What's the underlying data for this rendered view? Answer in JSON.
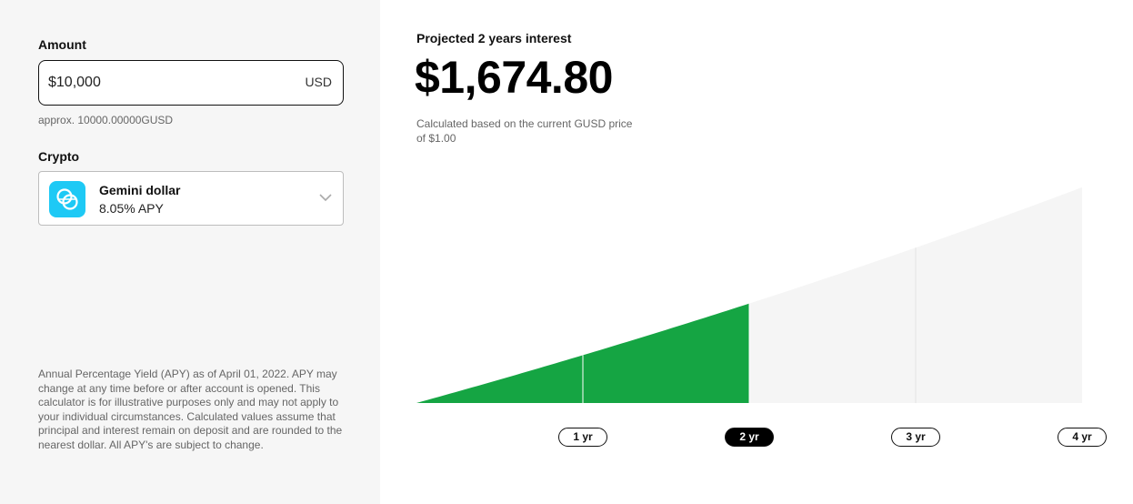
{
  "calculator": {
    "amount_label": "Amount",
    "amount_value": "$10,000",
    "amount_unit": "USD",
    "approx_text": "approx. 10000.00000GUSD",
    "crypto_label": "Crypto",
    "crypto": {
      "name": "Gemini dollar",
      "apy": "8.05% APY",
      "icon": "gemini-dollar-icon",
      "icon_color": "#1ec9f5"
    },
    "disclaimer": "Annual Percentage Yield (APY) as of April 01, 2022. APY may change at any time before or after account is opened. This calculator is for illustrative purposes only and may not apply to your individual circumstances. Calculated values assume that principal and interest remain on deposit and are rounded to the nearest dollar. All APY's are subject to change."
  },
  "projection": {
    "title": "Projected 2 years interest",
    "value": "$1,674.80",
    "note": "Calculated based on the current GUSD price of $1.00"
  },
  "chart_data": {
    "type": "area",
    "principal": 10000,
    "apy": 0.0805,
    "x": [
      0,
      1,
      2,
      3,
      4
    ],
    "y": [
      0,
      805.0,
      1674.8,
      2614.12,
      3628.6
    ],
    "selected_year": 2,
    "ylim": [
      0,
      3628.6
    ],
    "grid": false,
    "colors": {
      "highlight": "#15a543",
      "rest": "#f5f5f5"
    },
    "year_labels": [
      "1 yr",
      "2 yr",
      "3 yr",
      "4 yr"
    ]
  }
}
